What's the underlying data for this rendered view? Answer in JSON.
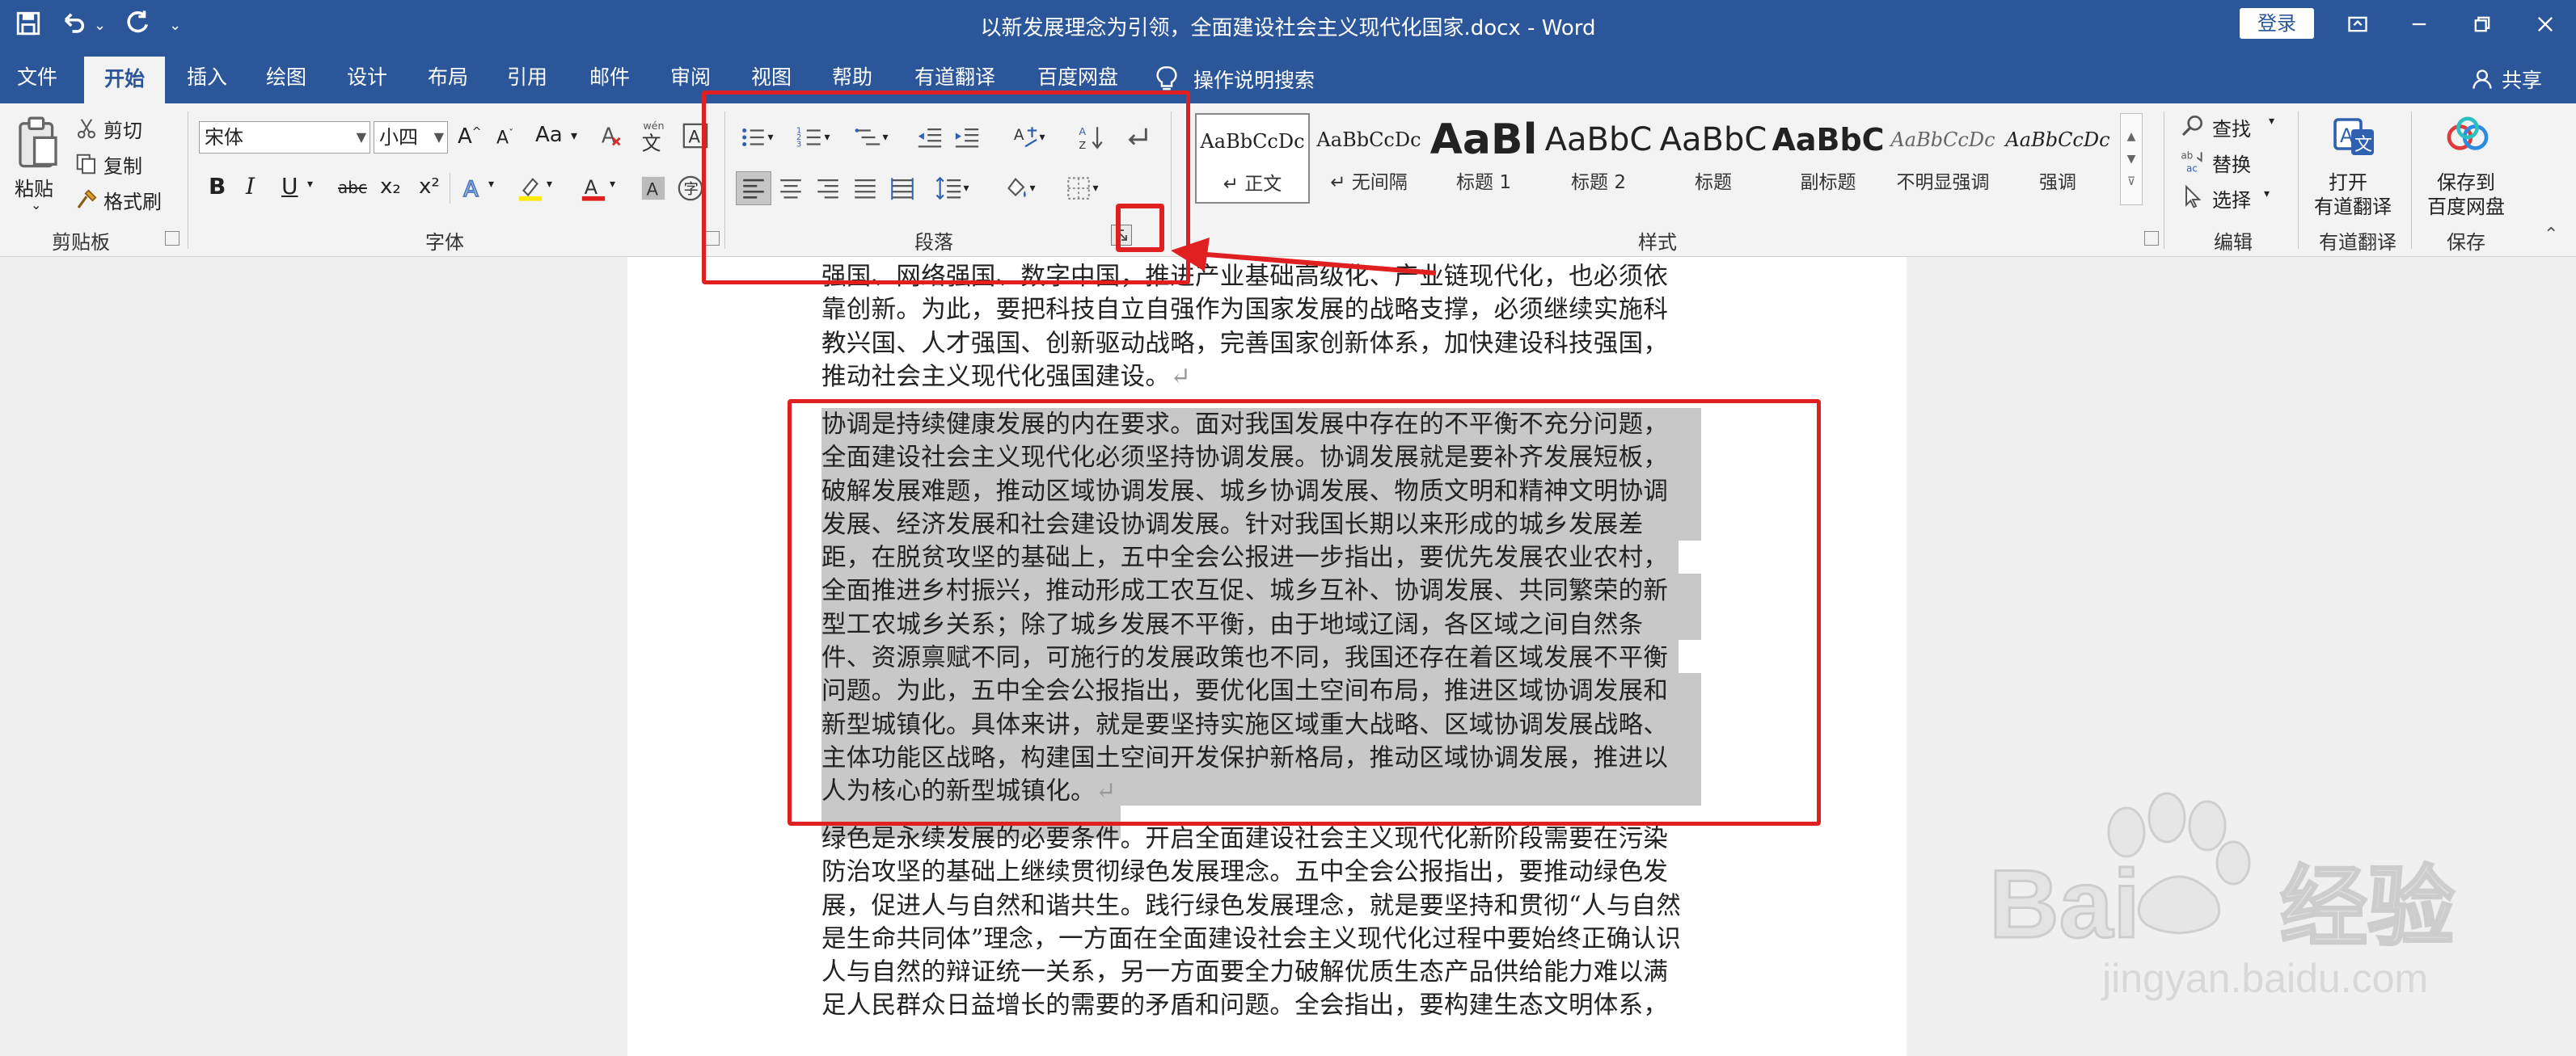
{
  "window": {
    "title": "以新发展理念为引领，全面建设社会主义现代化国家.docx  -  Word",
    "login_label": "登录"
  },
  "tabs": [
    "文件",
    "开始",
    "插入",
    "绘图",
    "设计",
    "布局",
    "引用",
    "邮件",
    "审阅",
    "视图",
    "帮助",
    "有道翻译",
    "百度网盘"
  ],
  "tell_me": "操作说明搜索",
  "share": "共享",
  "ribbon": {
    "clipboard": {
      "paste": "粘贴",
      "cut": "剪切",
      "copy": "复制",
      "format_painter": "格式刷",
      "group_label": "剪贴板"
    },
    "font": {
      "font_name": "宋体",
      "font_size": "小四",
      "group_label": "字体",
      "aa_label": "Aa",
      "bold": "B",
      "italic": "I",
      "underline": "U",
      "strikethrough": "abc",
      "subscript": "x₂",
      "superscript": "x²"
    },
    "paragraph": {
      "group_label": "段落"
    },
    "styles": {
      "group_label": "样式",
      "items": [
        {
          "sample": "AaBbCcDc",
          "name": "正文"
        },
        {
          "sample": "AaBbCcDc",
          "name": "无间隔"
        },
        {
          "sample": "AaBl",
          "name": "标题 1"
        },
        {
          "sample": "AaBbC",
          "name": "标题 2"
        },
        {
          "sample": "AaBbC",
          "name": "标题"
        },
        {
          "sample": "AaBbC",
          "name": "副标题"
        },
        {
          "sample": "AaBbCcDc",
          "name": "不明显强调"
        },
        {
          "sample": "AaBbCcDc",
          "name": "强调"
        }
      ]
    },
    "editing": {
      "find": "查找",
      "replace": "替换",
      "select": "选择",
      "group_label": "编辑"
    },
    "youdao": {
      "button": "打开\n有道翻译",
      "line1": "打开",
      "line2": "有道翻译",
      "group_label": "有道翻译"
    },
    "baidu": {
      "line1": "保存到",
      "line2": "百度网盘",
      "group_label": "保存"
    }
  },
  "document": {
    "para1_lines": [
      "强国、网络强国、数字中国，推进产业基础高级化、产业链现代化，也必须依",
      "靠创新。为此，要把科技自立自强作为国家发展的战略支撑，必须继续实施科",
      "教兴国、人才强国、创新驱动战略，完善国家创新体系，加快建设科技强国，",
      "推动社会主义现代化强国建设。"
    ],
    "para2_lines": [
      "协调是持续健康发展的内在要求。面对我国发展中存在的不平衡不充分问题，",
      "全面建设社会主义现代化必须坚持协调发展。协调发展就是要补齐发展短板，",
      "破解发展难题，推动区域协调发展、城乡协调发展、物质文明和精神文明协调",
      "发展、经济发展和社会建设协调发展。针对我国长期以来形成的城乡发展差",
      "距，在脱贫攻坚的基础上，五中全会公报进一步指出，要优先发展农业农村，",
      "全面推进乡村振兴，推动形成工农互促、城乡互补、协调发展、共同繁荣的新",
      "型工农城乡关系；除了城乡发展不平衡，由于地域辽阔，各区域之间自然条",
      "件、资源禀赋不同，可施行的发展政策也不同，我国还存在着区域发展不平衡",
      "问题。为此，五中全会公报指出，要优化国土空间布局，推进区域协调发展和",
      "新型城镇化。具体来讲，就是要坚持实施区域重大战略、区域协调发展战略、",
      "主体功能区战略，构建国土空间开发保护新格局，推动区域协调发展，推进以",
      "人为核心的新型城镇化。"
    ],
    "para3_lines": [
      "绿色是永续发展的必要条件。开启全面建设社会主义现代化新阶段需要在污染",
      "防治攻坚的基础上继续贯彻绿色发展理念。五中全会公报指出，要推动绿色发",
      "展，促进人与自然和谐共生。践行绿色发展理念，就是要坚持和贯彻“人与自然",
      "是生命共同体”理念，一方面在全面建设社会主义现代化过程中要始终正确认识",
      "人与自然的辩证统一关系，另一方面要全力破解优质生态产品供给能力难以满",
      "足人民群众日益增长的需要的矛盾和问题。全会指出，要构建生态文明体系，"
    ],
    "paragraph_mark": "↵"
  },
  "watermark": {
    "brand": "Bai 经验",
    "url": "jingyan.baidu.com"
  },
  "colors": {
    "title_bar": "#2b579a",
    "annotation_red": "#e02020",
    "highlight": "#c8c8c8"
  }
}
